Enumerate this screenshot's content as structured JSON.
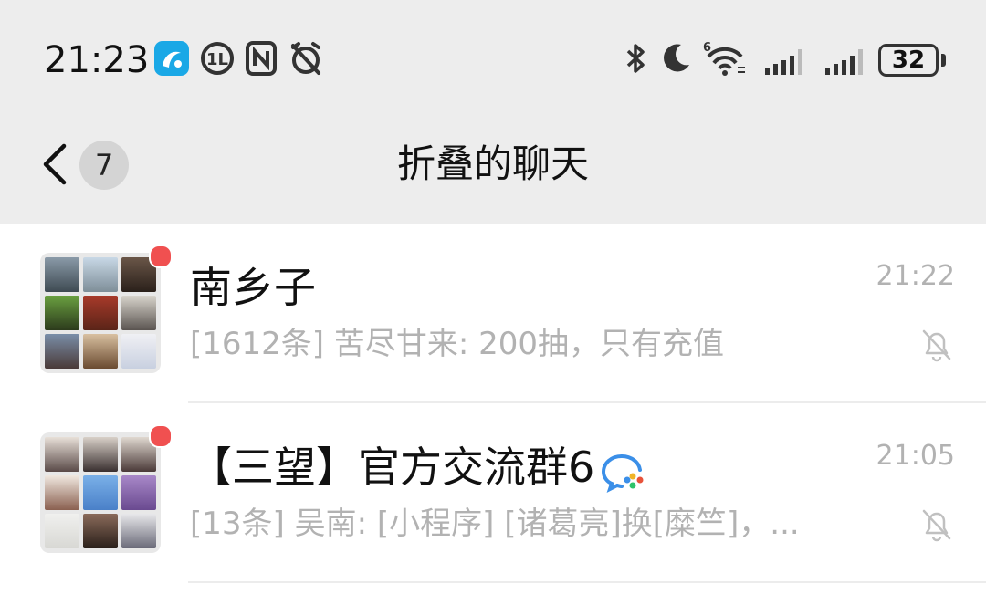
{
  "status_bar": {
    "time": "21:23",
    "left_icons": [
      "app-notification-icon",
      "hd-call-icon",
      "nfc-icon",
      "alarm-off-icon"
    ],
    "right_icons": [
      "bluetooth-icon",
      "do-not-disturb-moon-icon",
      "wifi-6-icon",
      "signal-icon",
      "signal-icon"
    ],
    "wifi_label": "6",
    "battery": "32"
  },
  "nav": {
    "title": "折叠的聊天",
    "unread_count": "7"
  },
  "chats": [
    {
      "name": "南乡子",
      "preview": "[1612条] 苦尽甘来: 200抽，只有充值",
      "time": "21:22",
      "muted": true,
      "unread_dot": true
    },
    {
      "name": "【三望】官方交流群6",
      "preview": "[13条] 吴南: [小程序] [诸葛亮]换[糜竺]，...",
      "time": "21:05",
      "muted": true,
      "unread_dot": true
    }
  ],
  "colors": {
    "header_bg": "#ededed",
    "unread_dot": "#f05050",
    "secondary_text": "#b2b2b2",
    "app_icon_blue": "#1aa8e6"
  }
}
